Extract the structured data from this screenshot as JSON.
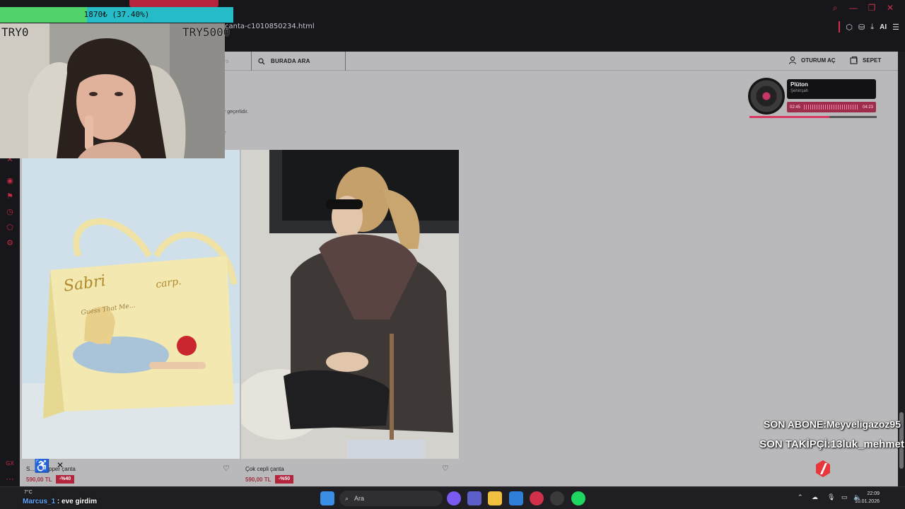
{
  "browser": {
    "url_fragment": "çanta-c1010850234.html",
    "ai_label": "AI"
  },
  "site": {
    "nav_fragment": "rs",
    "search_label": "BURADA ARA",
    "login_label": "OTURUM AÇ",
    "cart_label": "SEPET",
    "fragment_1": "r geçerlidir.",
    "fragment_2": "r"
  },
  "products": [
    {
      "name": "S...           r shopper çanta",
      "price": "590,00 TL",
      "discount": "-%40"
    },
    {
      "name": "Çok cepli çanta",
      "price": "590,00 TL",
      "discount": "-%50"
    }
  ],
  "music": {
    "title": "Plüton",
    "artist": "Şehinşah",
    "elapsed": "02:45",
    "duration": "04:23",
    "progress": 0.63
  },
  "goal": {
    "text": "1870₺ (37.40%)",
    "progress": 0.374,
    "min_label": "TRY0",
    "max_label": "TRY5000"
  },
  "overlay": {
    "last_sub": "SON ABONE:Meyveligazoz95",
    "last_follow": "SON TAKİPÇİ:13luk_mehmet"
  },
  "chat": {
    "user": "Marcus_1",
    "message": " : eve girdim"
  },
  "taskbar": {
    "search_placeholder": "Ara",
    "weather": "7°C",
    "time": "22:09",
    "date": "10.01.2026"
  },
  "colors": {
    "accent": "#d0304a",
    "page_bg": "#b9b9bb",
    "discount": "#b3253c"
  }
}
